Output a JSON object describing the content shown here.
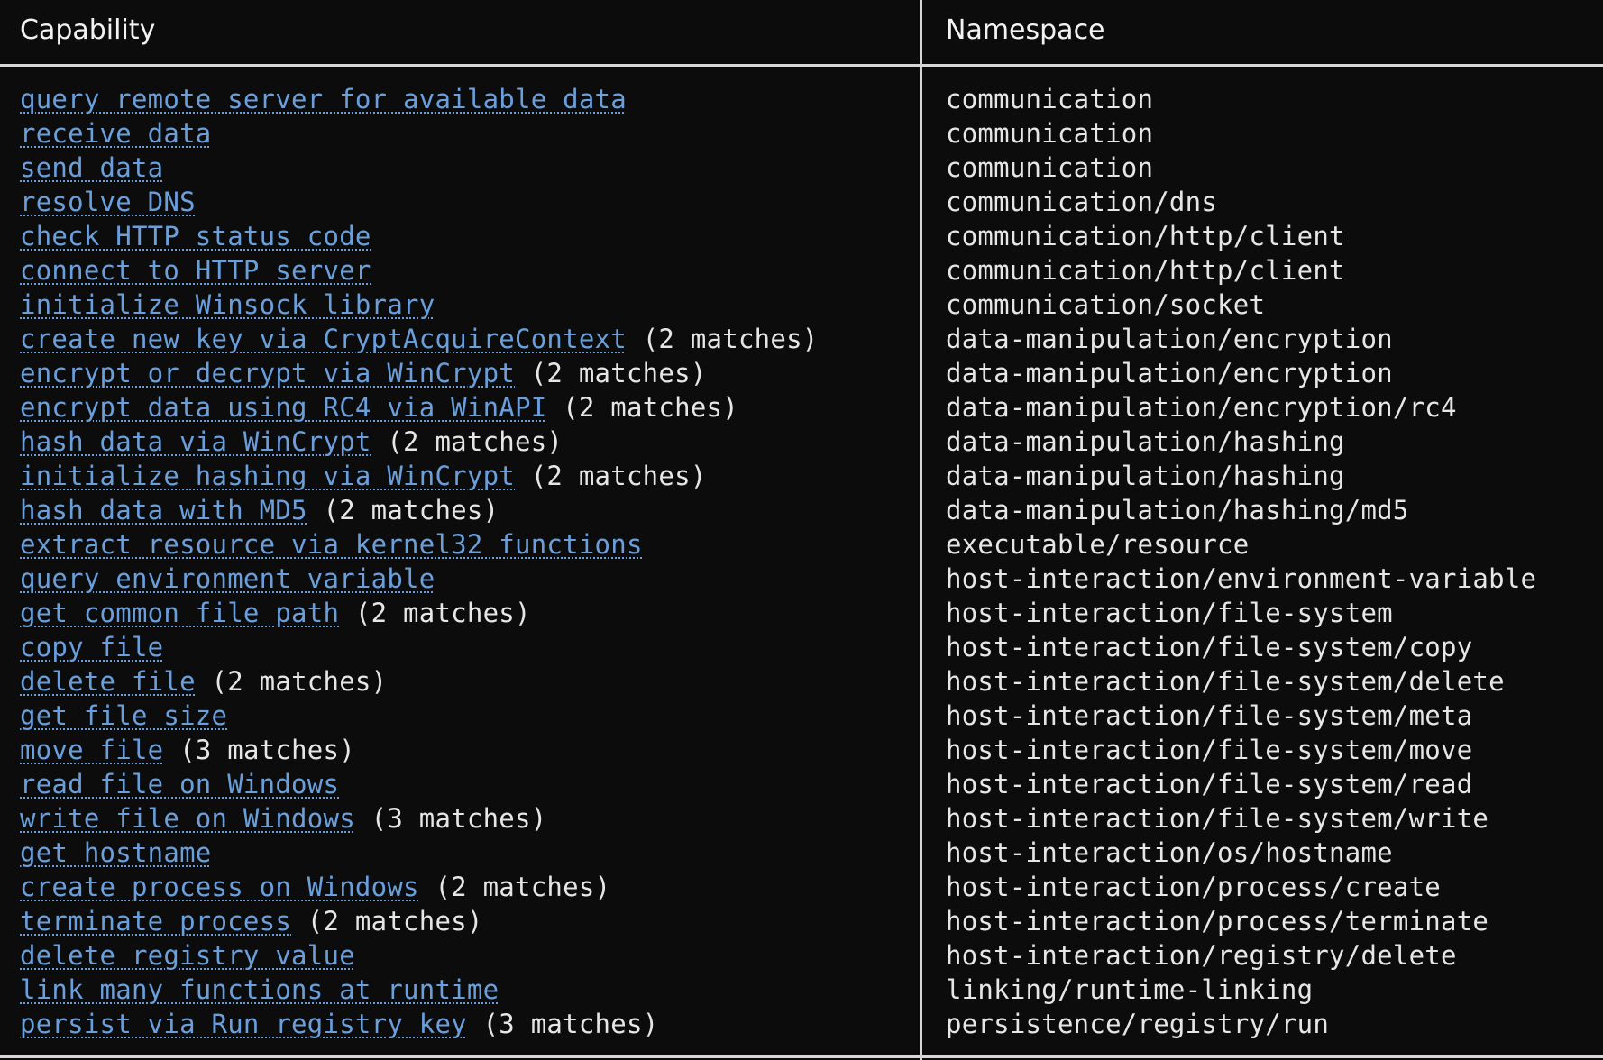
{
  "table": {
    "headers": {
      "capability": "Capability",
      "namespace": "Namespace"
    },
    "rows": [
      {
        "capability": "query remote server for available data",
        "matches": "",
        "namespace": "communication"
      },
      {
        "capability": "receive data",
        "matches": "",
        "namespace": "communication"
      },
      {
        "capability": "send data",
        "matches": "",
        "namespace": "communication"
      },
      {
        "capability": "resolve DNS",
        "matches": "",
        "namespace": "communication/dns"
      },
      {
        "capability": "check HTTP status code",
        "matches": "",
        "namespace": "communication/http/client"
      },
      {
        "capability": "connect to HTTP server",
        "matches": "",
        "namespace": "communication/http/client"
      },
      {
        "capability": "initialize Winsock library",
        "matches": "",
        "namespace": "communication/socket"
      },
      {
        "capability": "create new key via CryptAcquireContext",
        "matches": "(2 matches)",
        "namespace": "data-manipulation/encryption"
      },
      {
        "capability": "encrypt or decrypt via WinCrypt",
        "matches": "(2 matches)",
        "namespace": "data-manipulation/encryption"
      },
      {
        "capability": "encrypt data using RC4 via WinAPI",
        "matches": "(2 matches)",
        "namespace": "data-manipulation/encryption/rc4"
      },
      {
        "capability": "hash data via WinCrypt",
        "matches": "(2 matches)",
        "namespace": "data-manipulation/hashing"
      },
      {
        "capability": "initialize hashing via WinCrypt",
        "matches": "(2 matches)",
        "namespace": "data-manipulation/hashing"
      },
      {
        "capability": "hash data with MD5",
        "matches": "(2 matches)",
        "namespace": "data-manipulation/hashing/md5"
      },
      {
        "capability": "extract resource via kernel32 functions",
        "matches": "",
        "namespace": "executable/resource"
      },
      {
        "capability": "query environment variable",
        "matches": "",
        "namespace": "host-interaction/environment-variable"
      },
      {
        "capability": "get common file path",
        "matches": "(2 matches)",
        "namespace": "host-interaction/file-system"
      },
      {
        "capability": "copy file",
        "matches": "",
        "namespace": "host-interaction/file-system/copy"
      },
      {
        "capability": "delete file",
        "matches": "(2 matches)",
        "namespace": "host-interaction/file-system/delete"
      },
      {
        "capability": "get file size",
        "matches": "",
        "namespace": "host-interaction/file-system/meta"
      },
      {
        "capability": "move file",
        "matches": "(3 matches)",
        "namespace": "host-interaction/file-system/move"
      },
      {
        "capability": "read file on Windows",
        "matches": "",
        "namespace": "host-interaction/file-system/read"
      },
      {
        "capability": "write file on Windows",
        "matches": "(3 matches)",
        "namespace": "host-interaction/file-system/write"
      },
      {
        "capability": "get hostname",
        "matches": "",
        "namespace": "host-interaction/os/hostname"
      },
      {
        "capability": "create process on Windows",
        "matches": "(2 matches)",
        "namespace": "host-interaction/process/create"
      },
      {
        "capability": "terminate process",
        "matches": "(2 matches)",
        "namespace": "host-interaction/process/terminate"
      },
      {
        "capability": "delete registry value",
        "matches": "",
        "namespace": "host-interaction/registry/delete"
      },
      {
        "capability": "link many functions at runtime",
        "matches": "",
        "namespace": "linking/runtime-linking"
      },
      {
        "capability": "persist via Run registry key",
        "matches": "(3 matches)",
        "namespace": "persistence/registry/run"
      }
    ]
  },
  "colors": {
    "background": "#0c0c0c",
    "link": "#6a9fdc",
    "text": "#e6e6e6",
    "rule": "#d8d8d8"
  }
}
